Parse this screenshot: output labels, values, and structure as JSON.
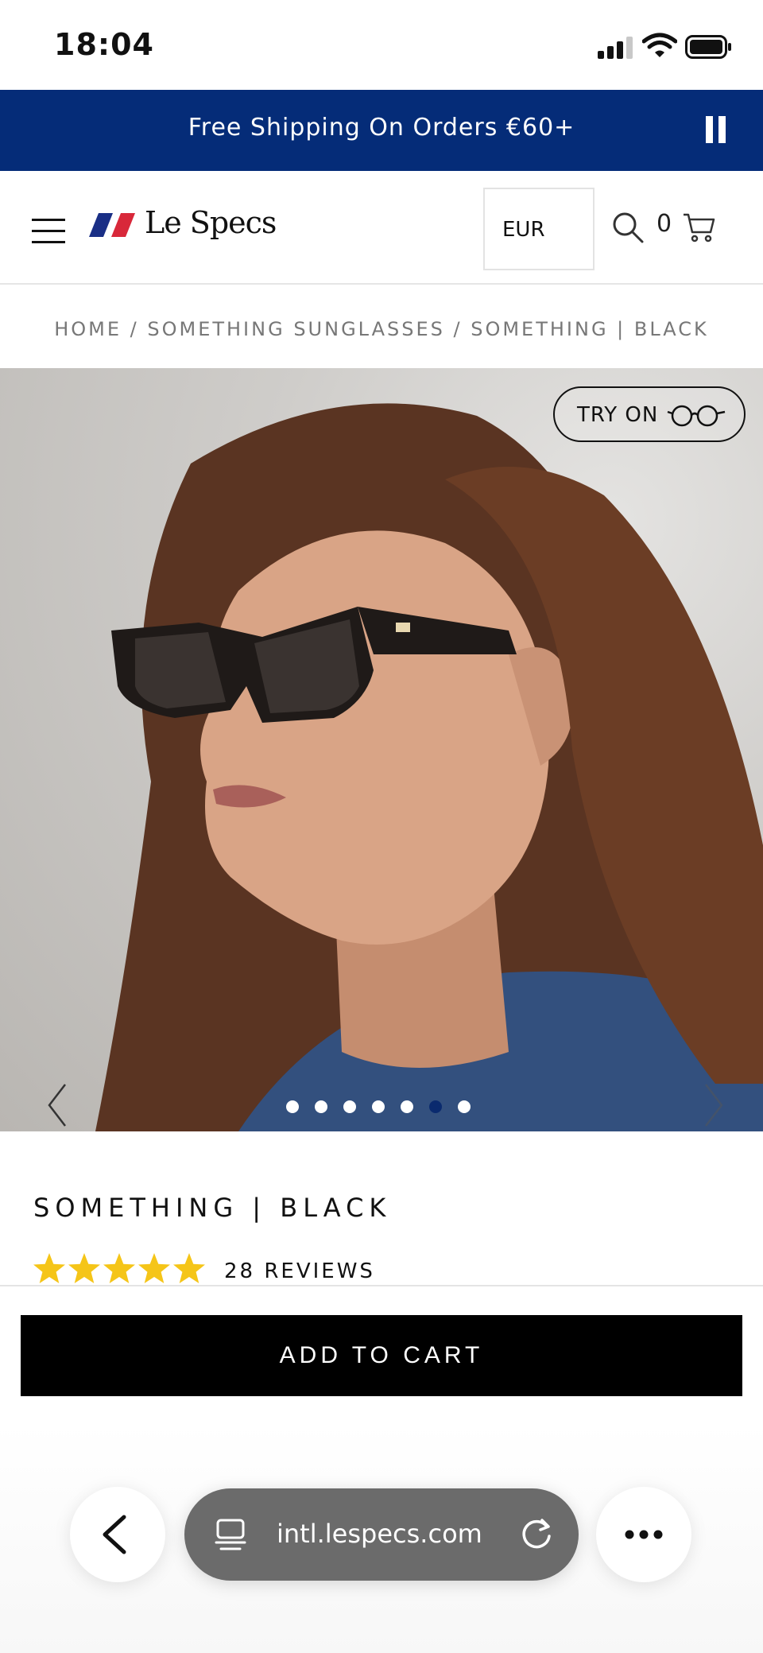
{
  "status_bar": {
    "time": "18:04"
  },
  "promo": {
    "text": "Free Shipping On Orders €60+"
  },
  "header": {
    "brand": "Le Specs",
    "currency": "EUR",
    "cart_count": "0"
  },
  "breadcrumb": {
    "text": "HOME / SOMETHING SUNGLASSES / SOMETHING | BLACK"
  },
  "gallery": {
    "try_on_label": "TRY ON",
    "slide_count": 7,
    "active_slide": 6
  },
  "product": {
    "title": "SOMETHING | BLACK",
    "rating": 5,
    "reviews_label": "28 REVIEWS"
  },
  "actions": {
    "add_to_cart": "ADD TO CART"
  },
  "browser": {
    "url": "intl.lespecs.com"
  },
  "colors": {
    "promo_bg": "#052c78",
    "star": "#f5c518",
    "active_dot": "#0a2a6e",
    "logo_blue": "#1a2f86",
    "logo_red": "#d8283a"
  }
}
